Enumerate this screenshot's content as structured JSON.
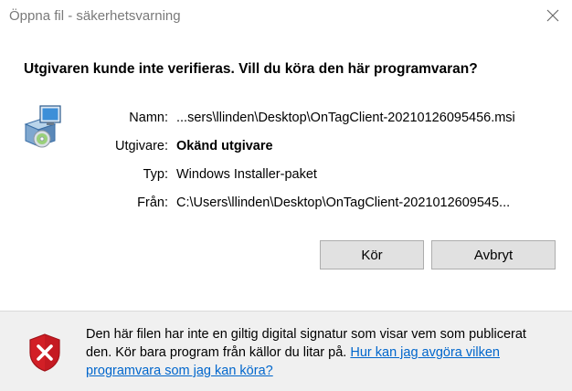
{
  "window": {
    "title": "Öppna fil - säkerhetsvarning"
  },
  "headline": "Utgivaren kunde inte verifieras. Vill du köra den här programvaran?",
  "details": {
    "name_label": "Namn:",
    "name_value": "...sers\\llinden\\Desktop\\OnTagClient-20210126095456.msi",
    "publisher_label": "Utgivare:",
    "publisher_value": "Okänd utgivare",
    "type_label": "Typ:",
    "type_value": "Windows Installer-paket",
    "from_label": "Från:",
    "from_value": "C:\\Users\\llinden\\Desktop\\OnTagClient-2021012609545..."
  },
  "buttons": {
    "run": "Kör",
    "cancel": "Avbryt"
  },
  "warning": {
    "text": "Den här filen har inte en giltig digital signatur som visar vem som publicerat den. Kör bara program från källor du litar på.",
    "link": "Hur kan jag avgöra vilken programvara som jag kan köra?"
  },
  "icons": {
    "close": "close-icon",
    "installer": "installer-package-icon",
    "shield": "security-shield-x-icon"
  },
  "colors": {
    "link": "#0066cc",
    "shield_red": "#d21f26",
    "button_bg": "#e1e1e1",
    "footer_bg": "#f0f0f0"
  }
}
